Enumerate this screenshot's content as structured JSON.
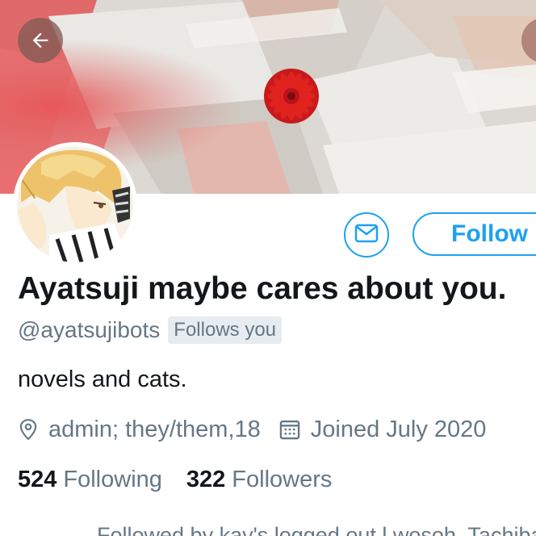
{
  "header": {
    "back_icon": "arrow-left-icon",
    "more_icon": "more-icon"
  },
  "profile": {
    "display_name": "Ayatsuji maybe cares about you.",
    "handle": "@ayatsujibots",
    "follows_you_badge": "Follows you",
    "bio": "novels and cats.",
    "location": "admin; they/them,18",
    "joined": "Joined July 2020",
    "following_count": "524",
    "following_label": "Following",
    "followers_count": "322",
    "followers_label": "Followers",
    "followed_by": "Followed by kay's logged out l.wosoh, Tachiba"
  },
  "actions": {
    "follow_label": "Follow",
    "message_icon": "mail-icon"
  },
  "colors": {
    "accent": "#1da1f2",
    "secondary_text": "#657786",
    "primary_text": "#14171a",
    "badge_bg": "#e6ecf0"
  }
}
